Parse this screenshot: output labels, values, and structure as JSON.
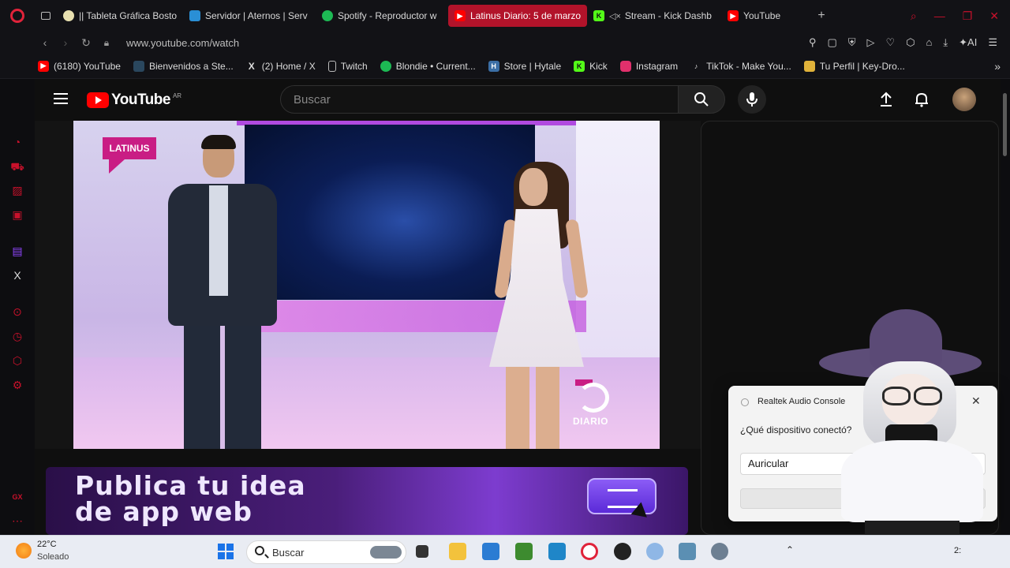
{
  "tabs": [
    {
      "label": "|| Tableta Gráfica Bosto",
      "icon": "tablet-icon",
      "color": "#e8e0b0",
      "active": false
    },
    {
      "label": "Servidor | Aternos | Serv",
      "icon": "aternos-icon",
      "color": "#2a8fd6",
      "active": false
    },
    {
      "label": "Spotify - Reproductor w",
      "icon": "spotify-icon",
      "color": "#1db954",
      "active": false
    },
    {
      "label": "Latinus Diario: 5 de marzo",
      "icon": "youtube-icon",
      "color": "#ff0000",
      "active": true
    },
    {
      "label": "Stream - Kick Dashb",
      "icon": "kick-icon",
      "color": "#53fc18",
      "active": false
    },
    {
      "label": "YouTube",
      "icon": "youtube-icon",
      "color": "#ff0000",
      "active": false
    }
  ],
  "address": {
    "url": "www.youtube.com/watch"
  },
  "bookmarks": [
    {
      "label": "(6180) YouTube",
      "icon": "youtube-icon",
      "color": "#ff0000"
    },
    {
      "label": "Bienvenidos a Ste...",
      "icon": "steam-icon",
      "color": "#2a475e"
    },
    {
      "label": "(2) Home / X",
      "icon": "x-icon",
      "color": "#000000"
    },
    {
      "label": "Twitch",
      "icon": "document-icon",
      "color": "#555555"
    },
    {
      "label": "Blondie • Current...",
      "icon": "spotify-icon",
      "color": "#1db954"
    },
    {
      "label": "Store | Hytale",
      "icon": "hytale-icon",
      "color": "#3b6ea5"
    },
    {
      "label": "Kick",
      "icon": "kick-icon",
      "color": "#53fc18"
    },
    {
      "label": "Instagram",
      "icon": "instagram-icon",
      "color": "#e1306c"
    },
    {
      "label": "TikTok - Make You...",
      "icon": "tiktok-icon",
      "color": "#111111"
    },
    {
      "label": "Tu Perfil | Key-Dro...",
      "icon": "keydrop-icon",
      "color": "#e0b23a"
    }
  ],
  "youtube": {
    "logo_text": "YouTube",
    "region": "AR",
    "search_placeholder": "Buscar"
  },
  "video": {
    "brand_logo": "LATINUS",
    "show_logo": "DIARIO"
  },
  "ad": {
    "line1": "Publica tu idea",
    "line2": "de app web"
  },
  "popup": {
    "title": "Realtek Audio Console",
    "question": "¿Qué dispositivo conectó?",
    "selected": "Auricular"
  },
  "taskbar": {
    "temperature": "22°C",
    "weather": "Soleado",
    "search_label": "Buscar",
    "clock_fragment": "2:"
  },
  "colors": {
    "accent": "#c8112b",
    "youtube_red": "#ff0000"
  }
}
